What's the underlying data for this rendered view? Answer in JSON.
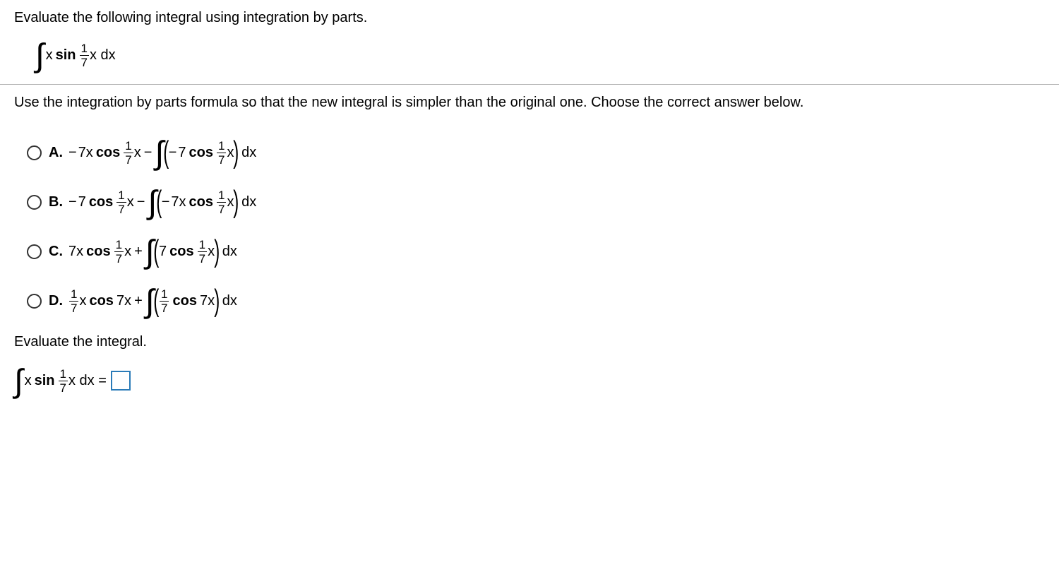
{
  "section1": {
    "instruction": "Evaluate the following integral using integration by parts.",
    "integral_expr": {
      "lhs_var": "x",
      "func": "sin",
      "frac_num": "1",
      "frac_den": "7",
      "tail": "x dx"
    }
  },
  "section2": {
    "instruction": "Use the integration by parts formula so that the new integral is simpler than the original one. Choose the correct answer below.",
    "options": {
      "A": {
        "label": "A.",
        "t1_sign": "−",
        "t1_coef": "7x",
        "t1_func": "cos",
        "t1_frac_num": "1",
        "t1_frac_den": "7",
        "t1_tail": "x",
        "op": "−",
        "t2_sign": "−",
        "t2_coef": "7",
        "t2_func": "cos",
        "t2_frac_num": "1",
        "t2_frac_den": "7",
        "t2_tail": "x",
        "dx": "dx"
      },
      "B": {
        "label": "B.",
        "t1_sign": "−",
        "t1_coef": "7",
        "t1_func": "cos",
        "t1_frac_num": "1",
        "t1_frac_den": "7",
        "t1_tail": "x",
        "op": "−",
        "t2_sign": "−",
        "t2_coef": "7x",
        "t2_func": "cos",
        "t2_frac_num": "1",
        "t2_frac_den": "7",
        "t2_tail": "x",
        "dx": "dx"
      },
      "C": {
        "label": "C.",
        "t1_sign": "",
        "t1_coef": "7x",
        "t1_func": "cos",
        "t1_frac_num": "1",
        "t1_frac_den": "7",
        "t1_tail": "x",
        "op": "+",
        "t2_sign": "",
        "t2_coef": "7",
        "t2_func": "cos",
        "t2_frac_num": "1",
        "t2_frac_den": "7",
        "t2_tail": "x",
        "dx": "dx"
      },
      "D": {
        "label": "D.",
        "t1_frac_num": "1",
        "t1_frac_den": "7",
        "t1_coef": "x",
        "t1_func": "cos",
        "t1_arg": "7x",
        "op": "+",
        "t2_frac_num": "1",
        "t2_frac_den": "7",
        "t2_func": "cos",
        "t2_arg": "7x",
        "dx": "dx"
      }
    },
    "eval_label": "Evaluate the integral.",
    "eval_expr": {
      "lhs_var": "x",
      "func": "sin",
      "frac_num": "1",
      "frac_den": "7",
      "tail": "x dx =",
      "eq": "="
    }
  }
}
